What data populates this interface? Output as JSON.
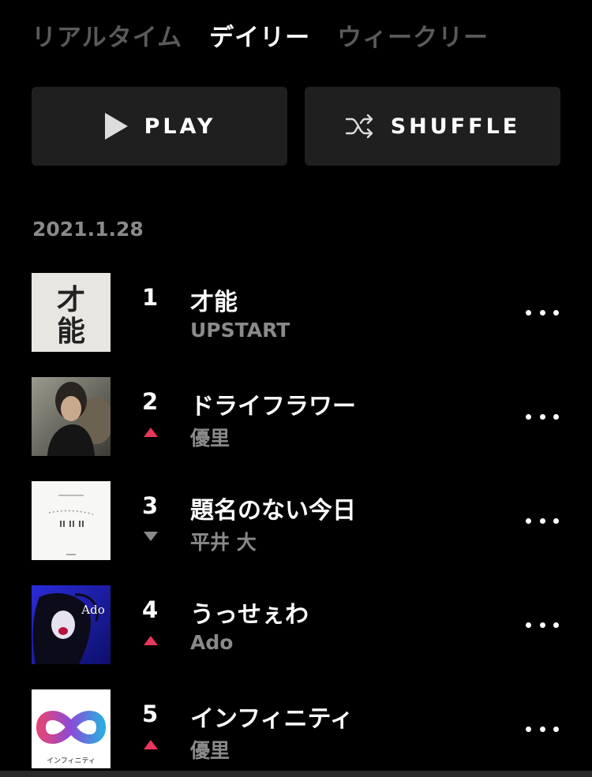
{
  "tabs": [
    {
      "label": "リアルタイム",
      "active": false
    },
    {
      "label": "デイリー",
      "active": true
    },
    {
      "label": "ウィークリー",
      "active": false
    }
  ],
  "actions": {
    "play_label": "PLAY",
    "shuffle_label": "SHUFFLE",
    "play_icon": "play-triangle-icon",
    "shuffle_icon": "shuffle-icon"
  },
  "chart_date": "2021.1.28",
  "tracks": [
    {
      "rank": "1",
      "title": "才能",
      "artist": "UPSTART",
      "trend": "none",
      "art_text": "才\n能"
    },
    {
      "rank": "2",
      "title": "ドライフラワー",
      "artist": "優里",
      "trend": "up"
    },
    {
      "rank": "3",
      "title": "題名のない今日",
      "artist": "平井 大",
      "trend": "down"
    },
    {
      "rank": "4",
      "title": "うっせぇわ",
      "artist": "Ado",
      "trend": "up",
      "art_text": "Ado"
    },
    {
      "rank": "5",
      "title": "インフィニティ",
      "artist": "優里",
      "trend": "up",
      "art_text": "インフィニティ"
    }
  ],
  "colors": {
    "background": "#000000",
    "button_bg": "#1f1f1f",
    "trend_up": "#e8365d",
    "trend_down": "#8a8a8a",
    "muted_text": "#8a8a8a",
    "inactive_tab": "#5a5a5a"
  }
}
